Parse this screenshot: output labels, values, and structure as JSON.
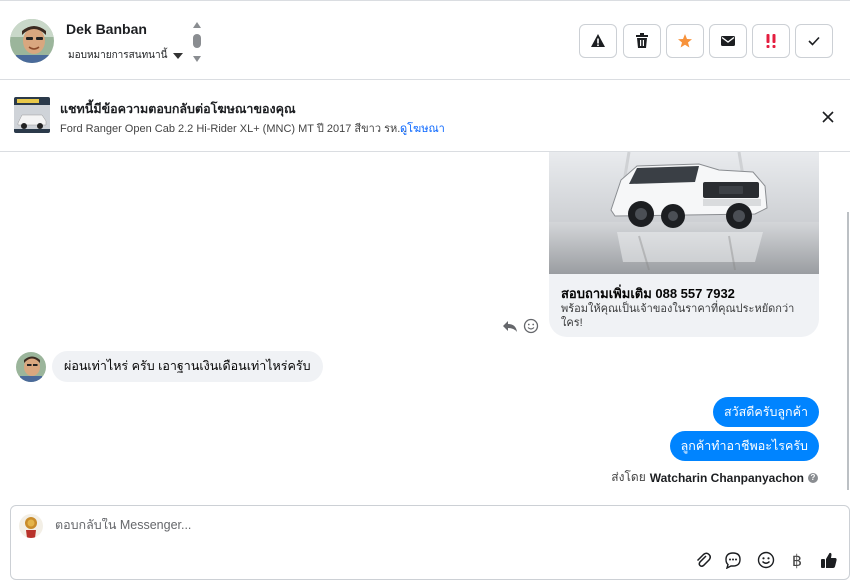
{
  "header": {
    "contact_name": "Dek Banban",
    "assign_label": "มอบหมายการสนทนานี้",
    "actions": [
      {
        "name": "spam-button",
        "icon": "warning-icon"
      },
      {
        "name": "delete-button",
        "icon": "trash-icon"
      },
      {
        "name": "star-button",
        "icon": "star-icon"
      },
      {
        "name": "mark-unread-button",
        "icon": "envelope-icon"
      },
      {
        "name": "follow-up-button",
        "icon": "exclamation-icon"
      },
      {
        "name": "done-button",
        "icon": "check-icon"
      }
    ]
  },
  "ad_banner": {
    "title": "แชทนี้มีข้อความตอบกลับต่อโฆษณาของคุณ",
    "description": "Ford Ranger Open Cab 2.2 Hi-Rider XL+ (MNC) MT ปี 2017 สีขาว รห...",
    "link": "ดูโฆษณา"
  },
  "thread": {
    "ad_card": {
      "title": "สอบถามเพิ่มเติม 088 557 7932",
      "subtitle": "พร้อมให้คุณเป็นเจ้าของในราคาที่คุณประหยัดกว่าใคร!"
    },
    "incoming_message": "ผ่อนเท่าไหร่ ครับ เอาฐานเงินเดือนเท่าไหร่ครับ",
    "outgoing_messages": [
      "สวัสดีครับลูกค้า",
      "ลูกค้าทำอาชีพอะไรครับ"
    ],
    "sent_by_prefix": "ส่งโดย",
    "sent_by_name": "Watcharin Chanpanyachon"
  },
  "composer": {
    "placeholder": "ตอบกลับใน Messenger..."
  },
  "colors": {
    "accent": "#0084ff",
    "star": "#f7923b",
    "follow_up": "#e41e3f"
  }
}
